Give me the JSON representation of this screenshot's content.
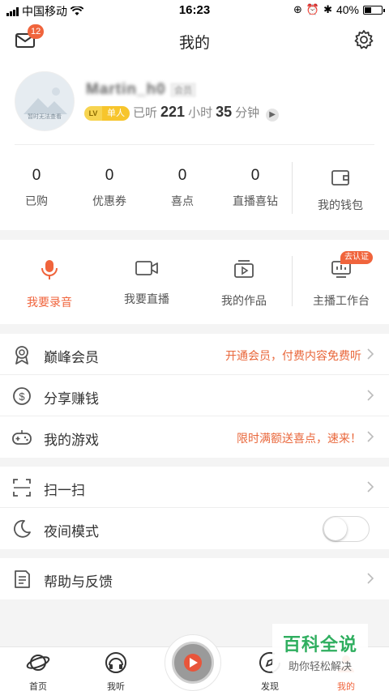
{
  "status_bar": {
    "carrier": "中国移动",
    "time": "16:23",
    "battery": "40%",
    "battery_level": 0.4
  },
  "header": {
    "title": "我的",
    "mail_badge": "12"
  },
  "profile": {
    "username": "Martin_h0",
    "vip_text": "会员",
    "avatar_caption": "暂时无法查看",
    "level_tag": "LV",
    "level_name": "单人",
    "listen_prefix": "已听",
    "listen_hours": "221",
    "hours_unit": "小时",
    "listen_minutes": "35",
    "minutes_unit": "分钟"
  },
  "stats": [
    {
      "value": "0",
      "label": "已购"
    },
    {
      "value": "0",
      "label": "优惠券"
    },
    {
      "value": "0",
      "label": "喜点"
    },
    {
      "value": "0",
      "label": "直播喜钻"
    }
  ],
  "wallet_label": "我的钱包",
  "actions": [
    {
      "label": "我要录音",
      "icon": "mic-icon"
    },
    {
      "label": "我要直播",
      "icon": "video-icon"
    },
    {
      "label": "我的作品",
      "icon": "works-icon"
    },
    {
      "label": "主播工作台",
      "icon": "workbench-icon"
    }
  ],
  "cert_badge": "去认证",
  "list_group1": [
    {
      "label": "巅峰会员",
      "extra": "开通会员，付费内容免费听"
    },
    {
      "label": "分享赚钱",
      "extra": ""
    },
    {
      "label": "我的游戏",
      "extra": "限时满额送喜点，速来！"
    }
  ],
  "list_group2": [
    {
      "label": "扫一扫"
    },
    {
      "label": "夜间模式",
      "toggle_on": false
    }
  ],
  "list_group3": [
    {
      "label": "帮助与反馈"
    }
  ],
  "tabs": [
    {
      "label": "首页"
    },
    {
      "label": "我听"
    },
    {
      "label": "发现"
    },
    {
      "label": "我的"
    }
  ],
  "colors": {
    "accent": "#f0643c",
    "extra_text": "#e9673b",
    "watermark_green": "#2fae5f"
  },
  "watermark": {
    "title": "百科全说",
    "subtitle": "助你轻松解决"
  }
}
